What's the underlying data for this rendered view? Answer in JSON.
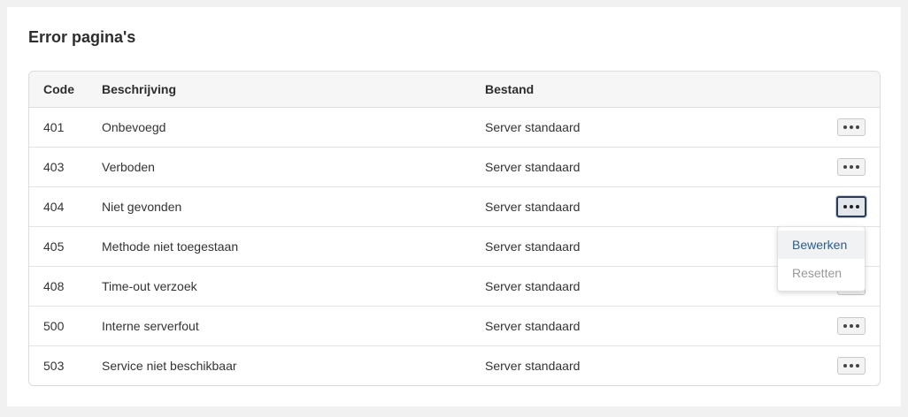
{
  "page": {
    "title": "Error pagina's"
  },
  "table": {
    "headers": {
      "code": "Code",
      "description": "Beschrijving",
      "file": "Bestand"
    },
    "rows": [
      {
        "code": "401",
        "description": "Onbevoegd",
        "file": "Server standaard"
      },
      {
        "code": "403",
        "description": "Verboden",
        "file": "Server standaard"
      },
      {
        "code": "404",
        "description": "Niet gevonden",
        "file": "Server standaard"
      },
      {
        "code": "405",
        "description": "Methode niet toegestaan",
        "file": "Server standaard"
      },
      {
        "code": "408",
        "description": "Time-out verzoek",
        "file": "Server standaard"
      },
      {
        "code": "500",
        "description": "Interne serverfout",
        "file": "Server standaard"
      },
      {
        "code": "503",
        "description": "Service niet beschikbaar",
        "file": "Server standaard"
      }
    ],
    "active_row": "404"
  },
  "dropdown": {
    "edit_label": "Bewerken",
    "reset_label": "Resetten"
  },
  "icons": {
    "row_actions": "more-dots-icon"
  },
  "colors": {
    "link": "#2b5e8a",
    "disabled": "#9a9a9a",
    "active_border": "#2d3c55"
  }
}
